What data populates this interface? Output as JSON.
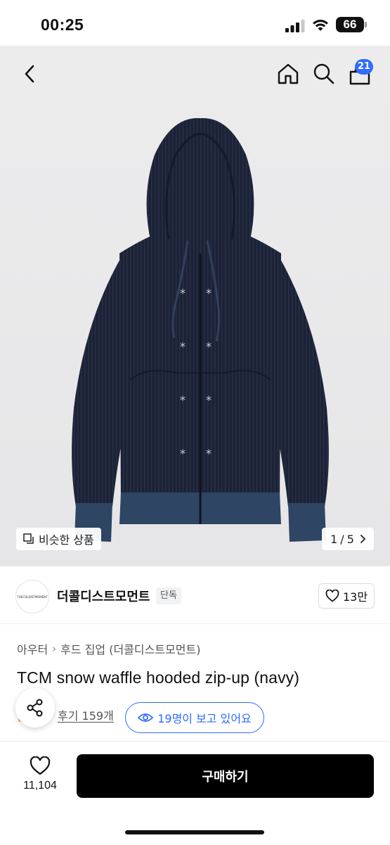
{
  "status_bar": {
    "time": "00:25",
    "battery": "66"
  },
  "header": {
    "cart_count": "21",
    "icons": [
      "back-icon",
      "home-icon",
      "search-icon",
      "cart-icon"
    ]
  },
  "gallery": {
    "similar_label": "비슷한 상품",
    "page_current": "1",
    "page_sep": "/",
    "page_total": "5"
  },
  "brand": {
    "logo_text": "THECOLDISTMOMENT",
    "name": "더콜디스트모먼트",
    "tag": "단독",
    "likes": "13만"
  },
  "product": {
    "breadcrumb": [
      "아우터",
      "후드 집업 (더콜디스트모먼트)"
    ],
    "title": "TCM snow waffle hooded zip-up (navy)",
    "reviews": "후기 159개",
    "viewers": "19명이 보고 있어요"
  },
  "bottom_bar": {
    "wish_count": "11,104",
    "buy_label": "구매하기"
  },
  "colors": {
    "accent": "#2f6bff",
    "buy_button": "#000000",
    "product_navy": "#1c2236",
    "ribbing": "#2e4563"
  }
}
